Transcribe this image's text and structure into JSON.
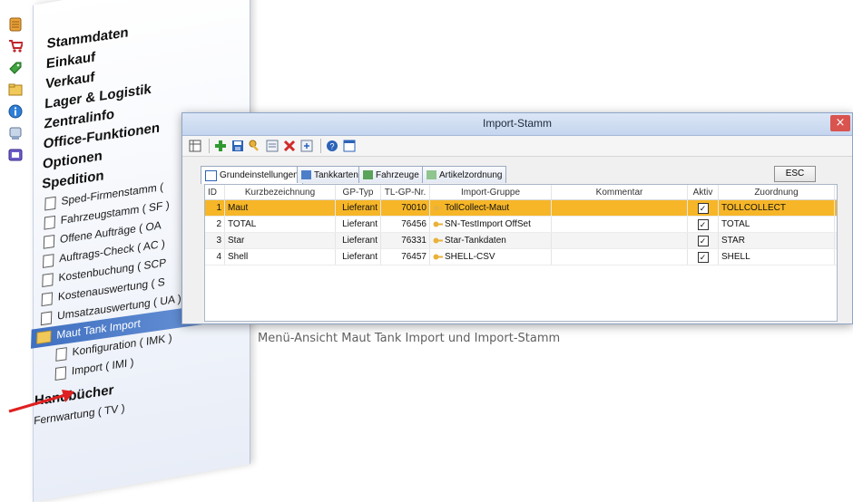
{
  "menu": {
    "main_items": [
      "Stammdaten",
      "Einkauf",
      "Verkauf",
      "Lager & Logistik",
      "Zentralinfo",
      "Office-Funktionen",
      "Optionen",
      "Spedition"
    ],
    "spedition_items": [
      "Sped-Firmenstamm (",
      "Fahrzeugstamm ( SF )",
      "Offene Aufträge ( OA",
      "Auftrags-Check ( AC )",
      "Kostenbuchung ( SCP",
      "Kostenauswertung ( S",
      "Umsatzauswertung ( UA )"
    ],
    "selected_folder": "Maut Tank Import",
    "folder_children": [
      "Konfiguration ( IMK )",
      "Import ( IMI )"
    ],
    "bottom_main": "Handbücher",
    "bottom_sub": "Fernwartung ( TV )"
  },
  "window": {
    "title": "Import-Stamm",
    "close_glyph": "×",
    "tabs": [
      "Grundeinstellungen",
      "Tankkarten",
      "Fahrzeuge",
      "Artikelzordnung"
    ],
    "esc_label": "ESC"
  },
  "grid": {
    "columns": [
      "ID",
      "Kurzbezeichnung",
      "GP-Typ",
      "TL-GP-Nr.",
      "Import-Gruppe",
      "Kommentar",
      "Aktiv",
      "Zuordnung"
    ],
    "rows": [
      {
        "id": "1",
        "kurz": "Maut",
        "gp_typ": "Lieferant",
        "tl_gp_nr": "70010",
        "gruppe": "TollCollect-Maut",
        "kommentar": "",
        "aktiv": "✓",
        "zuordnung": "TOLLCOLLECT"
      },
      {
        "id": "2",
        "kurz": "TOTAL",
        "gp_typ": "Lieferant",
        "tl_gp_nr": "76456",
        "gruppe": "SN-TestImport OffSet",
        "kommentar": "",
        "aktiv": "✓",
        "zuordnung": "TOTAL"
      },
      {
        "id": "3",
        "kurz": "Star",
        "gp_typ": "Lieferant",
        "tl_gp_nr": "76331",
        "gruppe": "Star-Tankdaten",
        "kommentar": "",
        "aktiv": "✓",
        "zuordnung": "STAR"
      },
      {
        "id": "4",
        "kurz": "Shell",
        "gp_typ": "Lieferant",
        "tl_gp_nr": "76457",
        "gruppe": "SHELL-CSV",
        "kommentar": "",
        "aktiv": "✓",
        "zuordnung": "SHELL"
      }
    ]
  },
  "caption": "Menü-Ansicht Maut Tank Import und Import-Stamm",
  "colors": {
    "selection": "#f6b628",
    "menu_selection": "#3f6fc0",
    "close": "#d9534f",
    "arrow": "#e02020"
  },
  "icons": {
    "strip": [
      "stammdaten-icon",
      "einkauf-cart-icon",
      "verkauf-tag-icon",
      "lager-folder-icon",
      "info-icon",
      "office-icon",
      "spedition-icon"
    ],
    "toolbar": [
      "grid-icon",
      "add-icon",
      "save-icon",
      "key-icon",
      "list-icon",
      "delete-icon",
      "import-icon",
      "help-icon",
      "window-icon"
    ]
  }
}
